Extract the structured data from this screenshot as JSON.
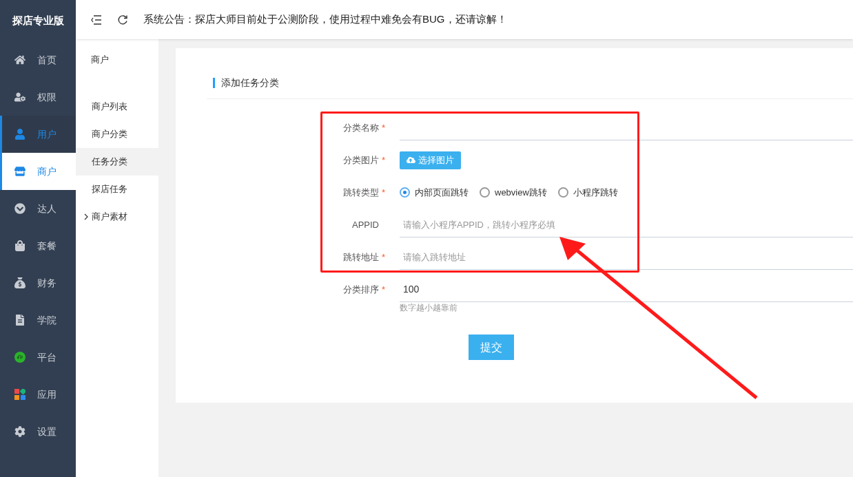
{
  "sidebar": {
    "brand": "探店专业版",
    "items": [
      {
        "label": "首页",
        "selected": false,
        "hover": false
      },
      {
        "label": "权限",
        "selected": false,
        "hover": false
      },
      {
        "label": "用户",
        "selected": false,
        "hover": true
      },
      {
        "label": "商户",
        "selected": true,
        "hover": false
      },
      {
        "label": "达人",
        "selected": false,
        "hover": false
      },
      {
        "label": "套餐",
        "selected": false,
        "hover": false
      },
      {
        "label": "财务",
        "selected": false,
        "hover": false
      },
      {
        "label": "学院",
        "selected": false,
        "hover": false
      },
      {
        "label": "平台",
        "selected": false,
        "hover": false
      },
      {
        "label": "应用",
        "selected": false,
        "hover": false
      },
      {
        "label": "设置",
        "selected": false,
        "hover": false
      }
    ]
  },
  "header": {
    "notice": "系统公告：探店大师目前处于公测阶段，使用过程中难免会有BUG，还请谅解！"
  },
  "submenu": {
    "title": "商户",
    "items": [
      {
        "label": "商户列表",
        "selected": false,
        "kind": "link"
      },
      {
        "label": "商户分类",
        "selected": false,
        "kind": "link"
      },
      {
        "label": "任务分类",
        "selected": true,
        "kind": "link"
      },
      {
        "label": "探店任务",
        "selected": false,
        "kind": "link"
      },
      {
        "label": "商户素材",
        "selected": false,
        "kind": "group",
        "expanded": false
      }
    ]
  },
  "form": {
    "title": "添加任务分类",
    "fields": [
      {
        "kind": "input",
        "label": "分类名称",
        "required_mark": "*"
      },
      {
        "kind": "upload",
        "label": "分类图片",
        "required_mark": "*",
        "button": "选择图片"
      },
      {
        "kind": "radio",
        "label": "跳转类型",
        "required_mark": "*",
        "options": [
          {
            "label": "内部页面跳转",
            "selected": true
          },
          {
            "label": "webview跳转",
            "selected": false
          },
          {
            "label": "小程序跳转",
            "selected": false
          }
        ]
      },
      {
        "kind": "input",
        "label": "APPID",
        "placeholder": "请输入小程序APPID，跳转小程序必填"
      },
      {
        "kind": "input",
        "label": "跳转地址",
        "required_mark": "*",
        "placeholder": "请输入跳转地址"
      },
      {
        "kind": "input",
        "label": "分类排序",
        "required_mark": "*",
        "value": "100",
        "hint": "数字越小越靠前"
      }
    ],
    "submit": "提交"
  }
}
